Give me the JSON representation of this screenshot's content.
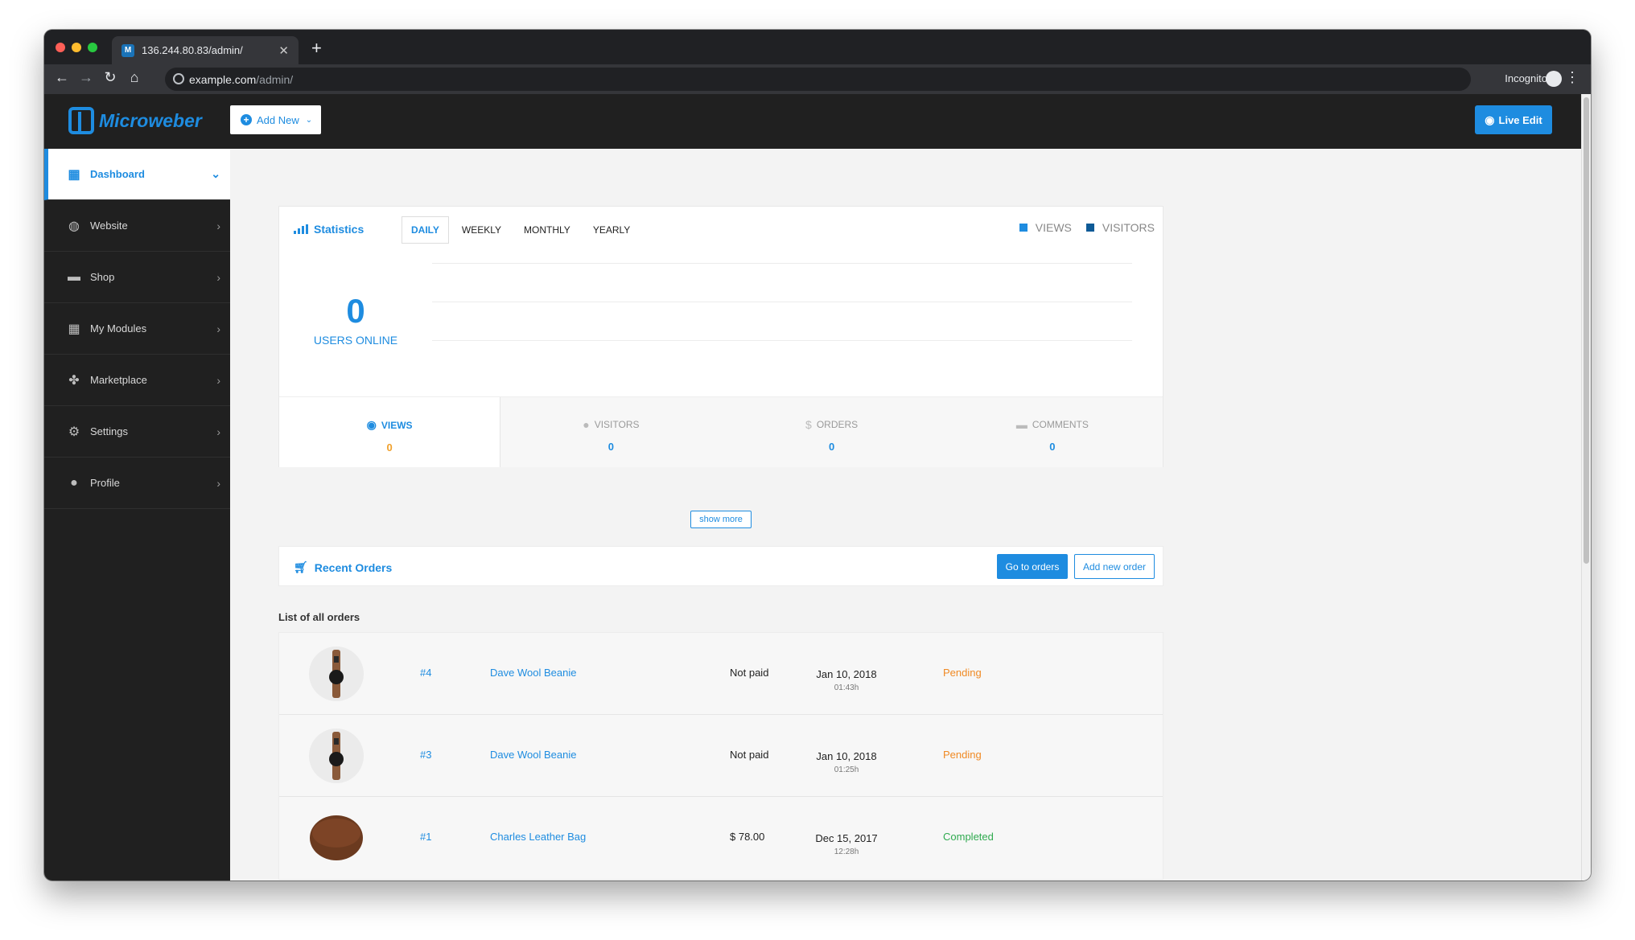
{
  "browser": {
    "tab_title": "136.244.80.83/admin/",
    "tab_favicon": "microweber-favicon",
    "url_host": "example.com",
    "url_path": "/admin/",
    "incognito_label": "Incognito"
  },
  "header": {
    "logo_text": "Microweber",
    "add_new_label": "Add New",
    "live_edit_label": "Live Edit"
  },
  "sidebar": {
    "items": [
      {
        "label": "Dashboard",
        "icon": "dashboard-icon",
        "active": true
      },
      {
        "label": "Website",
        "icon": "globe-icon"
      },
      {
        "label": "Shop",
        "icon": "shop-icon"
      },
      {
        "label": "My Modules",
        "icon": "grid-icon"
      },
      {
        "label": "Marketplace",
        "icon": "puzzle-icon"
      },
      {
        "label": "Settings",
        "icon": "gear-icon"
      },
      {
        "label": "Profile",
        "icon": "user-icon"
      }
    ]
  },
  "stats": {
    "title": "Statistics",
    "periods": [
      "DAILY",
      "WEEKLY",
      "MONTHLY",
      "YEARLY"
    ],
    "active_period": "DAILY",
    "legend": [
      {
        "label": "VIEWS",
        "color": "#1e8ce0"
      },
      {
        "label": "VISITORS",
        "color": "#0e5a96"
      }
    ],
    "users_online_value": "0",
    "users_online_label": "USERS ONLINE",
    "metrics": [
      {
        "label": "VIEWS",
        "value": "0",
        "icon": "eye-icon"
      },
      {
        "label": "VISITORS",
        "value": "0",
        "icon": "user-icon"
      },
      {
        "label": "ORDERS",
        "value": "0",
        "icon": "dollar-icon"
      },
      {
        "label": "COMMENTS",
        "value": "0",
        "icon": "comment-icon"
      }
    ],
    "show_more_label": "show more"
  },
  "orders": {
    "title": "Recent Orders",
    "go_to_orders_label": "Go to orders",
    "add_new_order_label": "Add new order",
    "list_caption": "List of all orders",
    "rows": [
      {
        "number": "#4",
        "product": "Dave Wool Beanie",
        "amount": "Not paid",
        "date": "Jan 10, 2018",
        "time": "01:43h",
        "status": "Pending",
        "status_color": "#f08a24",
        "thumb": "watch"
      },
      {
        "number": "#3",
        "product": "Dave Wool Beanie",
        "amount": "Not paid",
        "date": "Jan 10, 2018",
        "time": "01:25h",
        "status": "Pending",
        "status_color": "#f08a24",
        "thumb": "watch"
      },
      {
        "number": "#1",
        "product": "Charles Leather Bag",
        "amount": "$ 78.00",
        "date": "Dec 15, 2017",
        "time": "12:28h",
        "status": "Completed",
        "status_color": "#2faa4f",
        "thumb": "bag"
      }
    ]
  },
  "colors": {
    "accent": "#1e8ce0",
    "sidebar_bg": "#202020",
    "pending": "#f08a24",
    "completed": "#2faa4f"
  }
}
